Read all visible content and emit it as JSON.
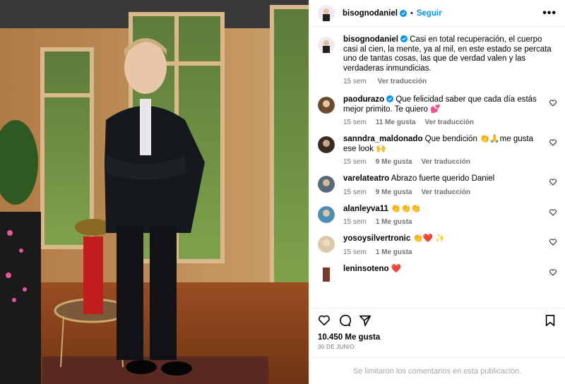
{
  "post": {
    "author": "bisognodaniel",
    "follow_label": "Seguir",
    "more_label": "•••",
    "likes": "10.450 Me gusta",
    "date": "30 DE JUNIO",
    "comments_limited": "Se limitaron los comentarios en esta publicación."
  },
  "caption": {
    "username": "bisognodaniel",
    "text": "Casi en total recuperación, el cuerpo casi al cien, la mente, ya al mil, en este estado se percata uno de tantas cosas, las que de verdad valen y las verdaderas inmundicias.",
    "time": "15 sem",
    "translate": "Ver traducción"
  },
  "comments": [
    {
      "username": "paodurazo",
      "text": "Que felicidad saber que cada día estás mejor primito. Te quiero 💕",
      "time": "15 sem",
      "likes": "11 Me gusta",
      "translate": "Ver traducción",
      "avatar_color": "#6b4a2e"
    },
    {
      "username": "sanndra_maldonado",
      "text": "Que bendición 👏🙏me gusta ese look 🙌",
      "time": "15 sem",
      "likes": "9 Me gusta",
      "translate": "Ver traducción",
      "avatar_color": "#3a2a22"
    },
    {
      "username": "varelateatro",
      "text": "Abrazo fuerte querido Daniel",
      "time": "15 sem",
      "likes": "9 Me gusta",
      "translate": "Ver traducción",
      "avatar_color": "#556b7a"
    },
    {
      "username": "alanleyva11",
      "text": "👏👏👏",
      "time": "15 sem",
      "likes": "1 Me gusta",
      "translate": "",
      "avatar_color": "#4a8fb0"
    },
    {
      "username": "yosoysilvertronic",
      "text": "👏❤️ ✨",
      "time": "15 sem",
      "likes": "1 Me gusta",
      "translate": "",
      "avatar_color": "#d9c9a8"
    },
    {
      "username": "leninsoteno",
      "text": "❤️",
      "time": "",
      "likes": "",
      "translate": "",
      "avatar_color": "#7a3a2a"
    }
  ],
  "colors": {
    "accent": "#0095f6",
    "verified": "#0095f6",
    "muted": "#737373"
  },
  "icons": [
    "verified-icon",
    "heart-icon",
    "comment-icon",
    "share-icon",
    "save-icon",
    "more-icon"
  ]
}
